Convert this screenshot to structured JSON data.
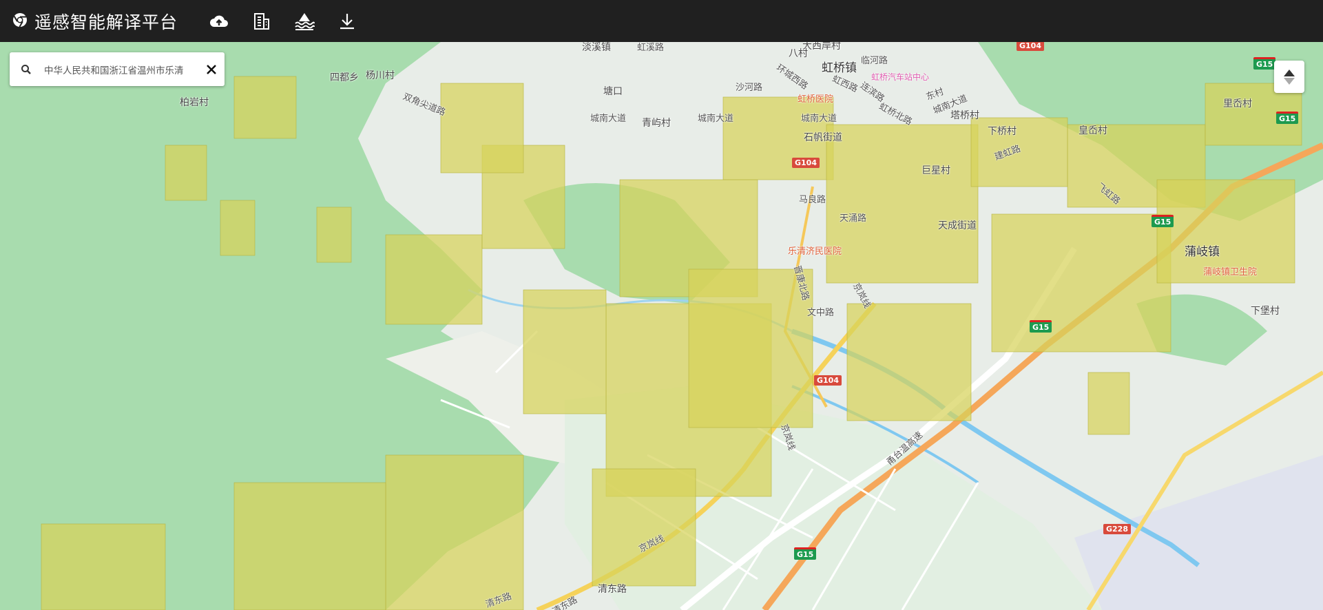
{
  "app": {
    "title": "遥感智能解译平台"
  },
  "toolbar": {
    "icons": [
      "chrome-logo-icon",
      "cloud-upload-icon",
      "building-icon",
      "water-layer-icon",
      "download-icon"
    ]
  },
  "search": {
    "value": "中华人民共和国浙江省温州市乐清"
  },
  "map": {
    "labels": [
      {
        "text": "淡溪镇"
      },
      {
        "text": "虹溪路"
      },
      {
        "text": "大西岸村"
      },
      {
        "text": "八村"
      },
      {
        "text": "虹桥镇"
      },
      {
        "text": "临河路"
      },
      {
        "text": "虹桥汽车站中心"
      },
      {
        "text": "四都乡"
      },
      {
        "text": "杨川村"
      },
      {
        "text": "柏岩村"
      },
      {
        "text": "双角尖道路"
      },
      {
        "text": "塘口"
      },
      {
        "text": "沙河路"
      },
      {
        "text": "环城西路"
      },
      {
        "text": "虹西路"
      },
      {
        "text": "虹桥医院"
      },
      {
        "text": "连滨路"
      },
      {
        "text": "城南大道"
      },
      {
        "text": "青屿村"
      },
      {
        "text": "城南大道"
      },
      {
        "text": "城南大道"
      },
      {
        "text": "东村"
      },
      {
        "text": "城南大道"
      },
      {
        "text": "虹桥北路"
      },
      {
        "text": "塔桥村"
      },
      {
        "text": "下桥村"
      },
      {
        "text": "皇岙村"
      },
      {
        "text": "里岙村"
      },
      {
        "text": "石帆街道"
      },
      {
        "text": "巨星村"
      },
      {
        "text": "建虹路"
      },
      {
        "text": "马良路"
      },
      {
        "text": "天涌路"
      },
      {
        "text": "天成街道"
      },
      {
        "text": "飞虹路"
      },
      {
        "text": "乐清济民医院"
      },
      {
        "text": "蒲岐镇"
      },
      {
        "text": "蒲岐镇卫生院"
      },
      {
        "text": "晋康北路"
      },
      {
        "text": "文中路"
      },
      {
        "text": "京岚线"
      },
      {
        "text": "下堡村"
      },
      {
        "text": "京岚线"
      },
      {
        "text": "甬台温高速"
      },
      {
        "text": "京岚线"
      },
      {
        "text": "清东路"
      },
      {
        "text": "清东路"
      },
      {
        "text": "清东路"
      }
    ],
    "shields": [
      {
        "text": "G104",
        "kind": "r"
      },
      {
        "text": "G15",
        "kind": "g"
      },
      {
        "text": "G104",
        "kind": "r"
      },
      {
        "text": "G15",
        "kind": "g"
      },
      {
        "text": "G15",
        "kind": "g"
      },
      {
        "text": "G104",
        "kind": "r"
      },
      {
        "text": "G15",
        "kind": "g"
      },
      {
        "text": "G228",
        "kind": "r"
      },
      {
        "text": "G15",
        "kind": "g"
      }
    ]
  },
  "colors": {
    "topbar": "#202020",
    "forest": "#a6dcab",
    "urban": "#f2f0ec",
    "buildings": "#d7d35a",
    "water": "#7fc8f0",
    "highway": "#f5a75a"
  }
}
